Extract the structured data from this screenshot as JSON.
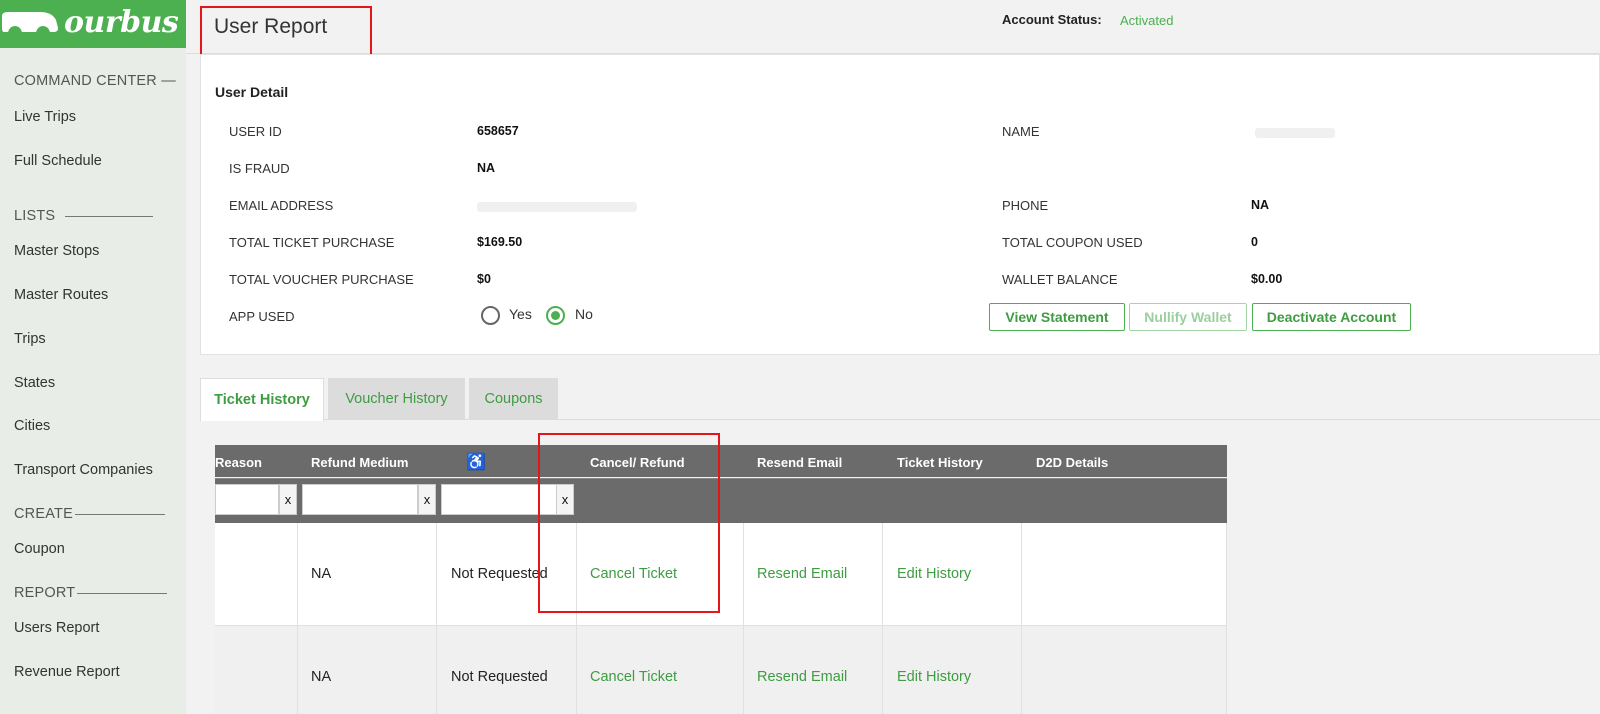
{
  "brand": {
    "name": "ourbus",
    "color": "#4caf50"
  },
  "sidebar": {
    "sections": [
      {
        "title": "COMMAND CENTER —",
        "items": [
          "Live Trips",
          "Full Schedule"
        ]
      },
      {
        "title": "LISTS",
        "items": [
          "Master Stops",
          "Master Routes",
          "Trips",
          "States",
          "Cities",
          "Transport Companies"
        ]
      },
      {
        "title": "CREATE",
        "items": [
          "Coupon"
        ]
      },
      {
        "title": "REPORT",
        "items": [
          "Users Report",
          "Revenue Report"
        ]
      }
    ]
  },
  "header": {
    "title": "User Report",
    "account_status_label": "Account Status:",
    "account_status_value": "Activated"
  },
  "user_detail": {
    "title": "User Detail",
    "left": [
      {
        "label": "USER ID",
        "value": "658657"
      },
      {
        "label": "IS FRAUD",
        "value": "NA"
      },
      {
        "label": "EMAIL ADDRESS",
        "value": ""
      },
      {
        "label": "TOTAL TICKET PURCHASE",
        "value": "$169.50"
      },
      {
        "label": "TOTAL VOUCHER PURCHASE",
        "value": "$0"
      },
      {
        "label": "APP USED",
        "value": ""
      }
    ],
    "right": [
      {
        "label": "NAME",
        "value": ""
      },
      {
        "label": "PHONE",
        "value": "NA"
      },
      {
        "label": "TOTAL COUPON USED",
        "value": "0"
      },
      {
        "label": "WALLET BALANCE",
        "value": "$0.00"
      }
    ],
    "app_used_options": {
      "yes": "Yes",
      "no": "No",
      "selected": "No"
    },
    "buttons": {
      "view_statement": "View Statement",
      "nullify_wallet": "Nullify Wallet",
      "deactivate_account": "Deactivate Account"
    }
  },
  "tabs": [
    {
      "label": "Ticket History",
      "active": true
    },
    {
      "label": "Voucher History",
      "active": false
    },
    {
      "label": "Coupons",
      "active": false
    }
  ],
  "table": {
    "columns": [
      "Reason",
      "Refund Medium",
      "♿",
      "Cancel/ Refund",
      "Resend Email",
      "Ticket History",
      "D2D Details"
    ],
    "filter_clear": "x",
    "rows": [
      {
        "refund_medium": "NA",
        "accessibility": "Not Requested",
        "cancel": "Cancel Ticket",
        "resend": "Resend Email",
        "history": "Edit History"
      },
      {
        "refund_medium": "NA",
        "accessibility": "Not Requested",
        "cancel": "Cancel Ticket",
        "resend": "Resend Email",
        "history": "Edit History"
      }
    ]
  }
}
